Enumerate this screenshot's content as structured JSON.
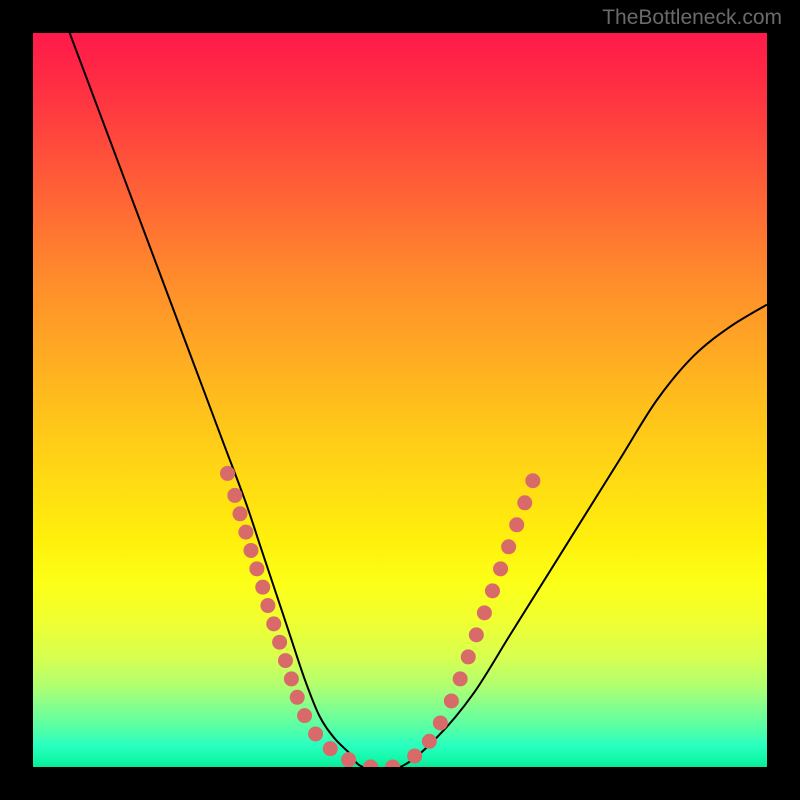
{
  "watermark": "TheBottleneck.com",
  "chart_data": {
    "type": "line",
    "title": "",
    "xlabel": "",
    "ylabel": "",
    "xlim": [
      0,
      100
    ],
    "ylim": [
      0,
      100
    ],
    "series": [
      {
        "name": "bottleneck-curve",
        "x": [
          5,
          8,
          11,
          14,
          17,
          20,
          23,
          26,
          29,
          31,
          33,
          35,
          37,
          39,
          41,
          43,
          45,
          50,
          55,
          60,
          65,
          70,
          75,
          80,
          85,
          90,
          95,
          100
        ],
        "y": [
          100,
          92,
          84,
          76,
          68,
          60,
          52,
          44,
          36,
          30,
          24,
          18,
          12,
          7,
          4,
          2,
          0,
          0,
          4,
          10,
          18,
          26,
          34,
          42,
          50,
          56,
          60,
          63
        ]
      }
    ],
    "markers": [
      {
        "x": 26.5,
        "y": 40
      },
      {
        "x": 27.5,
        "y": 37
      },
      {
        "x": 28.2,
        "y": 34.5
      },
      {
        "x": 29,
        "y": 32
      },
      {
        "x": 29.7,
        "y": 29.5
      },
      {
        "x": 30.5,
        "y": 27
      },
      {
        "x": 31.3,
        "y": 24.5
      },
      {
        "x": 32,
        "y": 22
      },
      {
        "x": 32.8,
        "y": 19.5
      },
      {
        "x": 33.6,
        "y": 17
      },
      {
        "x": 34.4,
        "y": 14.5
      },
      {
        "x": 35.2,
        "y": 12
      },
      {
        "x": 36,
        "y": 9.5
      },
      {
        "x": 37,
        "y": 7
      },
      {
        "x": 38.5,
        "y": 4.5
      },
      {
        "x": 40.5,
        "y": 2.5
      },
      {
        "x": 43,
        "y": 1
      },
      {
        "x": 46,
        "y": 0
      },
      {
        "x": 49,
        "y": 0
      },
      {
        "x": 52,
        "y": 1.5
      },
      {
        "x": 54,
        "y": 3.5
      },
      {
        "x": 55.5,
        "y": 6
      },
      {
        "x": 57,
        "y": 9
      },
      {
        "x": 58.2,
        "y": 12
      },
      {
        "x": 59.3,
        "y": 15
      },
      {
        "x": 60.4,
        "y": 18
      },
      {
        "x": 61.5,
        "y": 21
      },
      {
        "x": 62.6,
        "y": 24
      },
      {
        "x": 63.7,
        "y": 27
      },
      {
        "x": 64.8,
        "y": 30
      },
      {
        "x": 65.9,
        "y": 33
      },
      {
        "x": 67,
        "y": 36
      },
      {
        "x": 68.1,
        "y": 39
      }
    ],
    "marker_color": "#d86a6a",
    "marker_radius": 7.5,
    "curve_color": "#000000",
    "curve_width": 2
  }
}
